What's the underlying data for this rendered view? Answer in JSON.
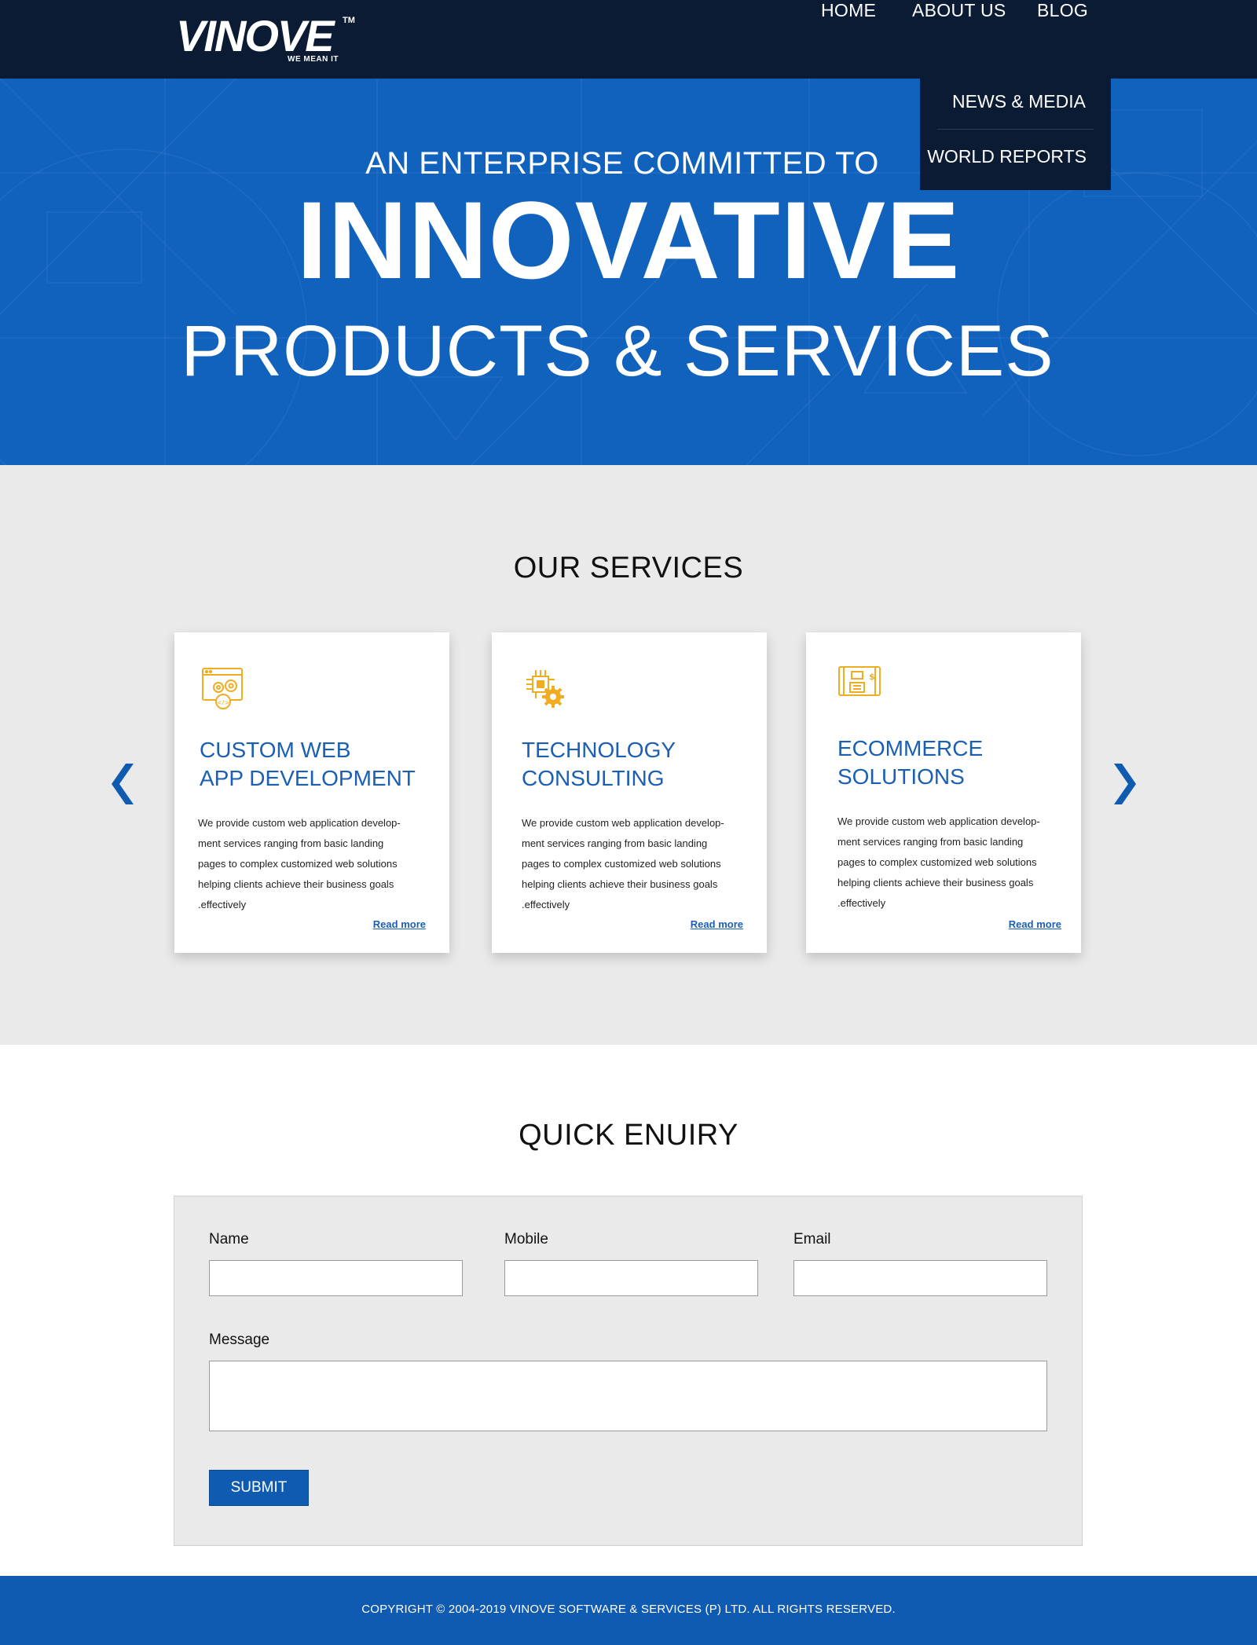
{
  "header": {
    "logo_text": "VINOVE",
    "logo_tm": "TM",
    "logo_tagline": "WE MEAN IT",
    "nav": [
      {
        "label": "HOME"
      },
      {
        "label": "ABOUT US"
      },
      {
        "label": "BLOG"
      }
    ],
    "dropdown": [
      {
        "label": "NEWS & MEDIA"
      },
      {
        "label": "WORLD REPORTS"
      }
    ]
  },
  "hero": {
    "line1": "AN ENTERPRISE COMMITTED TO",
    "line2": "INNOVATIVE",
    "line3": "PRODUCTS & SERVICES"
  },
  "services": {
    "title": "OUR SERVICES",
    "cards": [
      {
        "icon": "web-app-gears-icon",
        "title_line1": "CUSTOM WEB",
        "title_line2": "APP DEVELOPMENT",
        "desc": [
          "We provide custom web application develop-",
          "ment services ranging from basic landing",
          "pages to complex customized web solutions",
          "helping clients achieve their business goals",
          ".effectively"
        ],
        "link": "Read more"
      },
      {
        "icon": "chip-gear-icon",
        "title_line1": "TECHNOLOGY",
        "title_line2": "CONSULTING",
        "desc": [
          "We provide custom web application develop-",
          "ment services ranging from basic landing",
          "pages to complex customized web solutions",
          "helping clients achieve their business goals",
          ".effectively"
        ],
        "link": "Read more"
      },
      {
        "icon": "ecommerce-register-icon",
        "title_line1": "ECOMMERCE",
        "title_line2": "SOLUTIONS",
        "desc": [
          "We provide custom web application develop-",
          "ment services ranging from basic landing",
          "pages to complex customized web solutions",
          "helping clients achieve their business goals",
          ".effectively"
        ],
        "link": "Read more"
      }
    ],
    "accent_color": "#1a5fb4",
    "icon_color": "#f0ad22"
  },
  "enquiry": {
    "title": "QUICK ENUIRY",
    "fields": {
      "name_label": "Name",
      "mobile_label": "Mobile",
      "email_label": "Email",
      "message_label": "Message"
    },
    "submit_label": "SUBMIT"
  },
  "footer": {
    "copyright": "COPYRIGHT © 2004-2019 VINOVE SOFTWARE & SERVICES (P) LTD. ALL RIGHTS RESERVED."
  },
  "colors": {
    "header_bg": "#0b1b33",
    "hero_bg": "#1062bd",
    "footer_bg": "#0f5bb1",
    "services_bg": "#eaeaea"
  }
}
